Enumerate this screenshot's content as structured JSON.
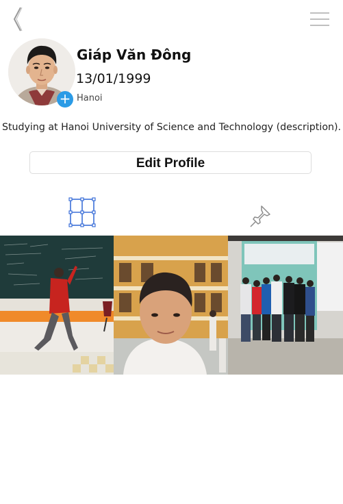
{
  "nav": {
    "back_icon": "chevron-left-icon",
    "menu_icon": "hamburger-menu-icon"
  },
  "profile": {
    "name": "Giáp Văn Đông",
    "dob": "13/01/1999",
    "location": "Hanoi",
    "description": "Studying at Hanoi University of Science and Technology (description).",
    "add_photo_icon": "plus-icon"
  },
  "actions": {
    "edit_label": "Edit Profile"
  },
  "tabs": [
    {
      "icon": "grid-icon",
      "active": true
    },
    {
      "icon": "pin-icon",
      "active": false
    }
  ],
  "colors": {
    "accent": "#2b9be6",
    "tab_active": "#3b6fd8",
    "tab_inactive": "#8a8a8a"
  },
  "photos": [
    {
      "subject": "chalkboard-photo"
    },
    {
      "subject": "selfie-photo"
    },
    {
      "subject": "group-photo"
    }
  ]
}
